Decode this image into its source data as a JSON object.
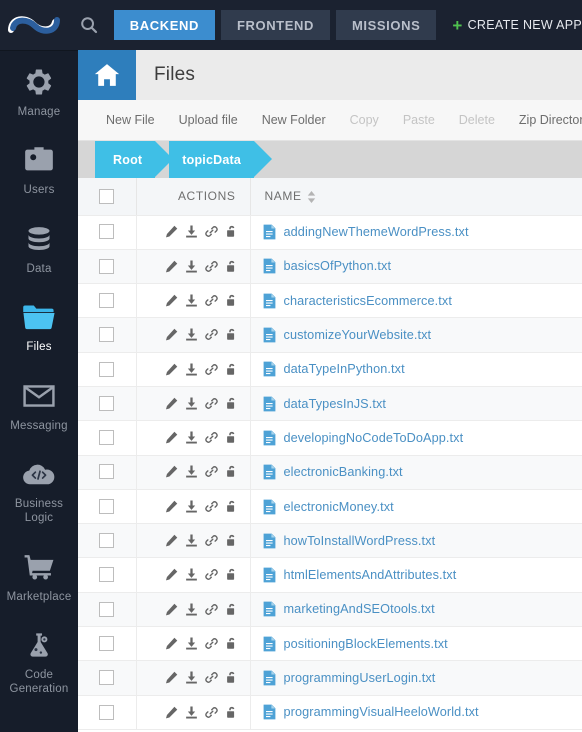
{
  "topbar": {
    "logo_name": "infinity-logo",
    "search_icon": "search-icon",
    "tabs": [
      {
        "label": "BACKEND",
        "active": true
      },
      {
        "label": "FRONTEND",
        "active": false
      },
      {
        "label": "MISSIONS",
        "active": false
      }
    ],
    "create_app": {
      "label": "CREATE NEW APP",
      "icon": "plus-icon",
      "color": "#4fc24f"
    },
    "active_tab_color": "#3c8dcf",
    "background": "#1b2230"
  },
  "sidebar": {
    "background": "#161d2a",
    "items": [
      {
        "label": "Manage",
        "icon": "gear-icon",
        "active": false
      },
      {
        "label": "Users",
        "icon": "users-badge-icon",
        "active": false
      },
      {
        "label": "Data",
        "icon": "database-icon",
        "active": false
      },
      {
        "label": "Files",
        "icon": "folder-icon",
        "active": true
      },
      {
        "label": "Messaging",
        "icon": "envelope-icon",
        "active": false
      },
      {
        "label": "Business Logic",
        "icon": "code-cloud-icon",
        "active": false
      },
      {
        "label": "Marketplace",
        "icon": "cart-icon",
        "active": false
      },
      {
        "label": "Code Generation",
        "icon": "flask-gear-icon",
        "active": false
      }
    ]
  },
  "page": {
    "home_icon": "home-icon",
    "home_button_color": "#2e7ebc",
    "title": "Files"
  },
  "toolbar": {
    "items": [
      {
        "label": "New File",
        "disabled": false
      },
      {
        "label": "Upload file",
        "disabled": false
      },
      {
        "label": "New Folder",
        "disabled": false
      },
      {
        "label": "Copy",
        "disabled": true
      },
      {
        "label": "Paste",
        "disabled": true
      },
      {
        "label": "Delete",
        "disabled": true
      },
      {
        "label": "Zip Directory",
        "disabled": false
      }
    ]
  },
  "breadcrumb": {
    "color": "#3fbfe6",
    "items": [
      {
        "label": "Root"
      },
      {
        "label": "topicData"
      }
    ]
  },
  "table": {
    "columns": {
      "actions": "ACTIONS",
      "name": "NAME"
    },
    "sort_icon": "sort-updown-icon",
    "row_actions": [
      {
        "icon": "pencil-icon",
        "title": "edit"
      },
      {
        "icon": "download-icon",
        "title": "download"
      },
      {
        "icon": "link-icon",
        "title": "link"
      },
      {
        "icon": "unlock-icon",
        "title": "permissions"
      }
    ],
    "rows": [
      {
        "name": "addingNewThemeWordPress.txt"
      },
      {
        "name": "basicsOfPython.txt"
      },
      {
        "name": "characteristicsEcommerce.txt"
      },
      {
        "name": "customizeYourWebsite.txt"
      },
      {
        "name": "dataTypeInPython.txt"
      },
      {
        "name": "dataTypesInJS.txt"
      },
      {
        "name": "developingNoCodeToDoApp.txt"
      },
      {
        "name": "electronicBanking.txt"
      },
      {
        "name": "electronicMoney.txt"
      },
      {
        "name": "howToInstallWordPress.txt"
      },
      {
        "name": "htmlElementsAndAttributes.txt"
      },
      {
        "name": "marketingAndSEOtools.txt"
      },
      {
        "name": "positioningBlockElements.txt"
      },
      {
        "name": "programmingUserLogin.txt"
      },
      {
        "name": "programmingVisualHeeloWorld.txt"
      }
    ]
  }
}
